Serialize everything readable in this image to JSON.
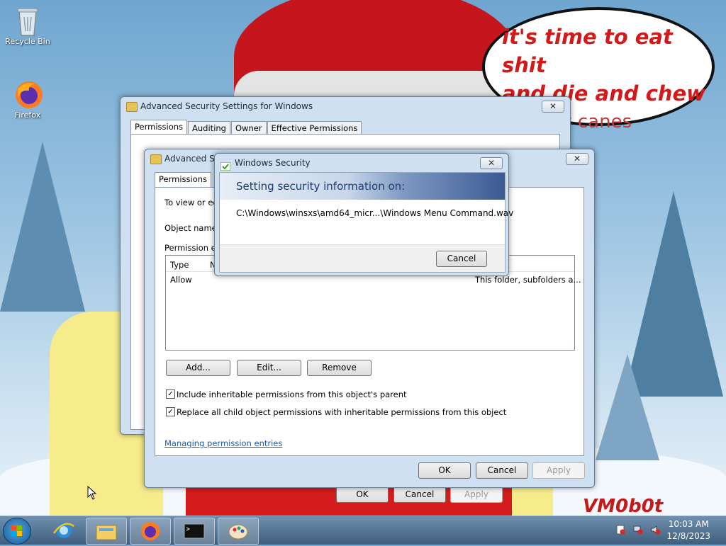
{
  "wallpaper": {
    "bubble_line1": "it's time to eat shit",
    "bubble_line2": "and die and chew",
    "bubble_line3": "candy canes",
    "signature": "VM0b0t"
  },
  "desktop": {
    "icons": [
      {
        "label": "Recycle Bin",
        "icon": "recycle-bin-icon"
      },
      {
        "label": "Firefox",
        "icon": "firefox-icon"
      }
    ]
  },
  "adv_back": {
    "title": "Advanced Security Settings for Windows",
    "tabs": [
      "Permissions",
      "Auditing",
      "Owner",
      "Effective Permissions"
    ],
    "buttons": {
      "ok": "OK",
      "cancel": "Cancel",
      "apply": "Apply"
    }
  },
  "adv_front": {
    "title": "Advanced Se",
    "tab": "Permissions",
    "intro": "To view or edit",
    "object_name_label": "Object name:",
    "entries_label": "Permission entri",
    "columns": [
      "Type",
      "N"
    ],
    "row": {
      "type": "Allow",
      "applies": "This folder, subfolders a..."
    },
    "buttons": {
      "add": "Add...",
      "edit": "Edit...",
      "remove": "Remove",
      "ok": "OK",
      "cancel": "Cancel",
      "apply": "Apply"
    },
    "checkbox1": "Include inheritable permissions from this object's parent",
    "checkbox2": "Replace all child object permissions with inheritable permissions from this object",
    "link": "Managing permission entries"
  },
  "security_dialog": {
    "title": "Windows Security",
    "header": "Setting security information on:",
    "path": "C:\\Windows\\winsxs\\amd64_micr...\\Windows Menu Command.wav",
    "cancel": "Cancel"
  },
  "taskbar": {
    "items": [
      "ie-icon",
      "explorer-icon",
      "firefox-icon",
      "cmd-icon",
      "paint-icon"
    ],
    "time": "10:03 AM",
    "date": "12/8/2023"
  },
  "colors": {
    "accent": "#1a5aa8",
    "titlebar": "#cfe0f0",
    "wallpaper_text": "#d21a1a"
  }
}
